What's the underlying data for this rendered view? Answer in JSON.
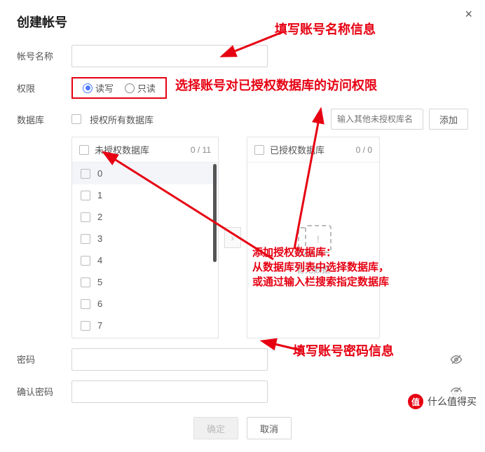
{
  "modal": {
    "title": "创建帐号",
    "close": "×"
  },
  "fields": {
    "account_name_label": "帐号名称",
    "permission_label": "权限",
    "database_label": "数据库",
    "password_label": "密码",
    "confirm_password_label": "确认密码"
  },
  "permissions": {
    "readwrite": "读写",
    "readonly": "只读"
  },
  "database": {
    "authorize_all": "授权所有数据库",
    "search_placeholder": "输入其他未授权库名",
    "add_button": "添加",
    "unauthorized_title": "未授权数据库",
    "unauthorized_count": "0 / 11",
    "authorized_title": "已授权数据库",
    "authorized_count": "0 / 0",
    "items": [
      "0",
      "1",
      "2",
      "3",
      "4",
      "5",
      "6",
      "7"
    ],
    "empty_text": "暂无数据",
    "transfer": "›"
  },
  "footer": {
    "ok": "确定",
    "cancel": "取消"
  },
  "annotations": {
    "a1": "填写账号名称信息",
    "a2": "选择账号对已授权数据库的访问权限",
    "a3_l1": "添加授权数据库：",
    "a3_l2": "从数据库列表中选择数据库，",
    "a3_l3": "或通过输入栏搜索指定数据库",
    "a4": "填写账号密码信息"
  },
  "watermark": {
    "badge": "值",
    "text": "什么值得买"
  }
}
